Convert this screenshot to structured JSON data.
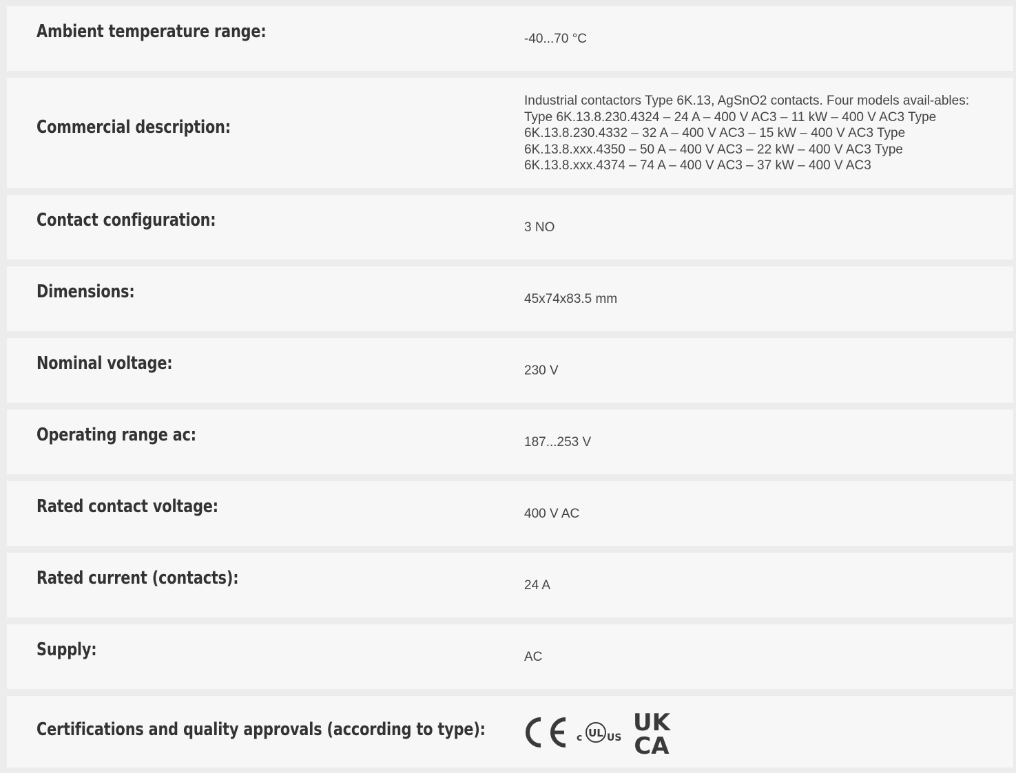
{
  "specs": [
    {
      "label": "Ambient temperature range:",
      "value": "-40...70 °C"
    },
    {
      "label": "Commercial description:",
      "value": "Industrial contactors Type 6K.13, AgSnO2 contacts.  Four models avail-ables:    Type 6K.13.8.230.4324 – 24 A – 400 V AC3 – 11 kW – 400 V AC3  Type 6K.13.8.230.4332 – 32 A – 400 V AC3 – 15 kW – 400 V AC3  Type 6K.13.8.xxx.4350 – 50 A – 400 V AC3 – 22 kW – 400 V AC3  Type 6K.13.8.xxx.4374 – 74 A – 400 V AC3 – 37 kW – 400 V AC3"
    },
    {
      "label": "Contact configuration:",
      "value": "3 NO"
    },
    {
      "label": "Dimensions:",
      "value": "45x74x83.5 mm"
    },
    {
      "label": "Nominal voltage:",
      "value": "230 V"
    },
    {
      "label": "Operating range ac:",
      "value": "187...253 V"
    },
    {
      "label": "Rated contact voltage:",
      "value": "400 V AC"
    },
    {
      "label": "Rated current (contacts):",
      "value": "24 A"
    },
    {
      "label": "Supply:",
      "value": "AC"
    }
  ],
  "certifications": {
    "label": "Certifications and quality approvals (according to type):",
    "logos": [
      "ce-mark-icon",
      "c-ul-us-icon",
      "ukca-icon"
    ],
    "ul_c": "c",
    "ul_mark": "UL",
    "ul_us": "US",
    "ukca_top": "UK",
    "ukca_bottom": "CA"
  }
}
